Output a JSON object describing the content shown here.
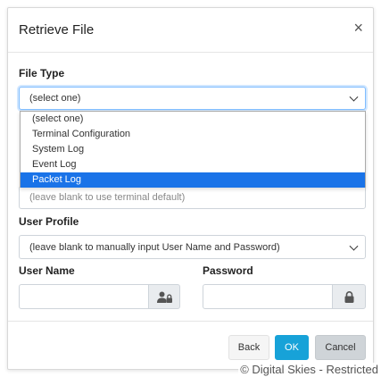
{
  "dialog": {
    "title": "Retrieve File",
    "close_glyph": "×"
  },
  "file_type": {
    "label": "File Type",
    "selected": "(select one)",
    "options": [
      "(select one)",
      "Terminal Configuration",
      "System Log",
      "Event Log",
      "Packet Log"
    ],
    "highlighted": "Packet Log"
  },
  "terminal_field": {
    "placeholder": "(leave blank to use terminal default)"
  },
  "user_profile": {
    "label": "User Profile",
    "selected": "(leave blank to manually input User Name and Password)"
  },
  "user_name": {
    "label": "User Name",
    "value": "",
    "icon": "user-lock-icon"
  },
  "password": {
    "label": "Password",
    "value": "",
    "icon": "lock-icon"
  },
  "buttons": {
    "back": "Back",
    "ok": "OK",
    "cancel": "Cancel"
  },
  "watermark": "© Digital Skies - Restricted",
  "colors": {
    "ok_button": "#17a2d8",
    "highlight": "#1a73e8",
    "cancel_button": "#cfd4d8"
  }
}
